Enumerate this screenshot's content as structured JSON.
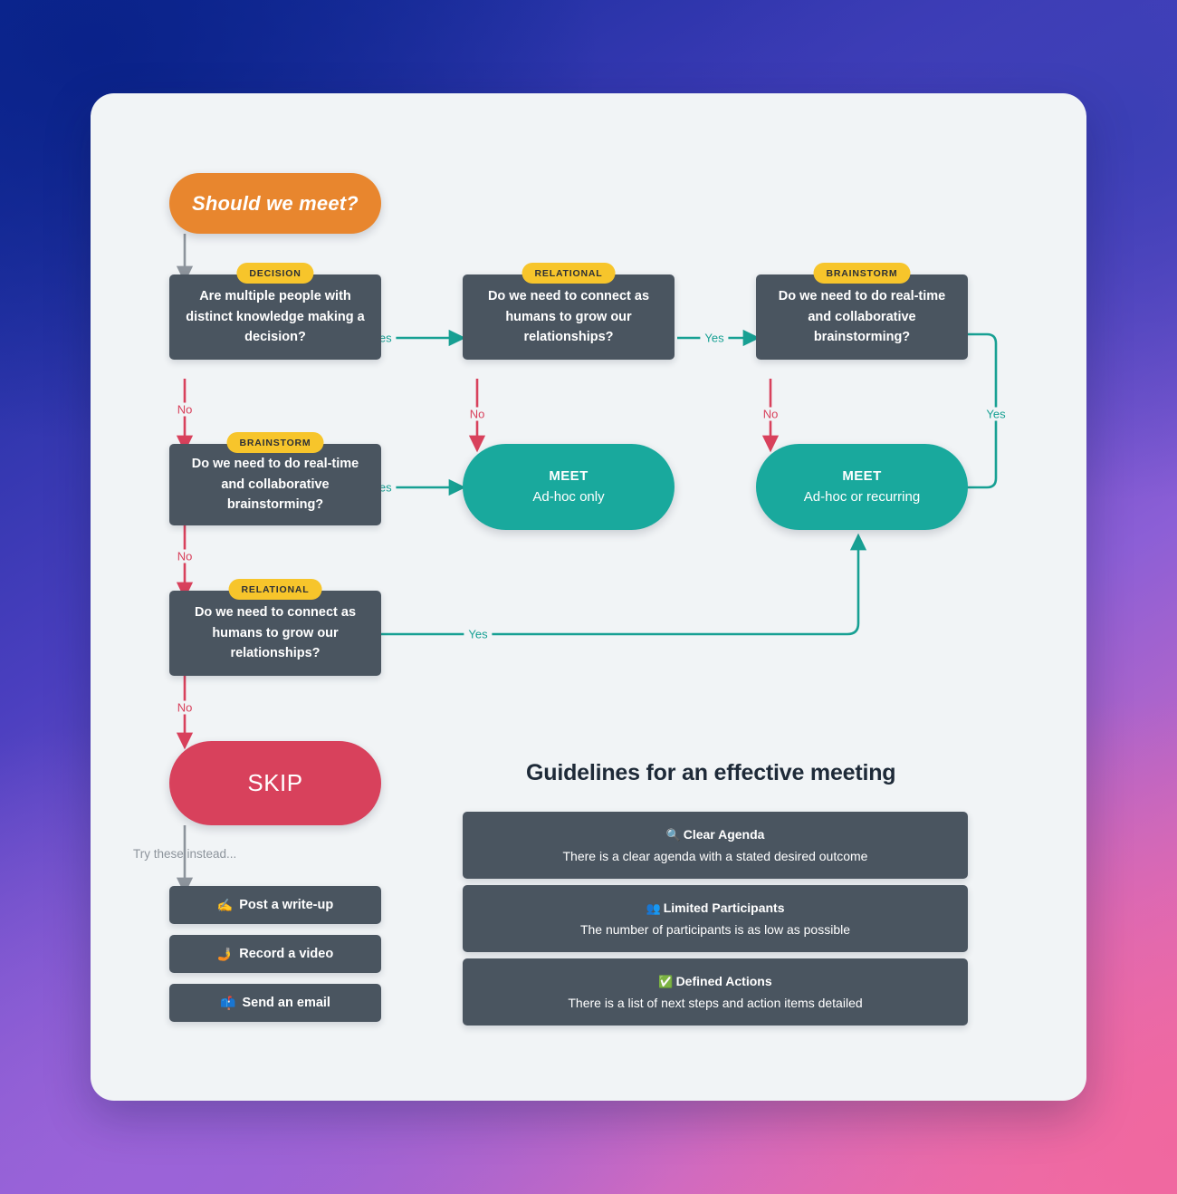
{
  "card": {
    "background": "#f1f4f6"
  },
  "colors": {
    "start": "#e8862e",
    "question": "#4a5560",
    "tag": "#f7c52b",
    "meet": "#19a99d",
    "skip": "#d8415c",
    "yes": "#17a093",
    "no": "#d8415c",
    "muted": "#8d949c"
  },
  "flow": {
    "start": {
      "label": "Should we meet?"
    },
    "q_decision": {
      "tag": "DECISION",
      "text": "Are multiple people with distinct knowledge making a decision?"
    },
    "q_relational_top": {
      "tag": "RELATIONAL",
      "text": "Do we need to connect as humans to grow our relationships?"
    },
    "q_brainstorm_top": {
      "tag": "BRAINSTORM",
      "text": "Do we need to do real-time and collaborative brainstorming?"
    },
    "q_brainstorm_left": {
      "tag": "BRAINSTORM",
      "text": "Do we need to do real-time and collaborative brainstorming?"
    },
    "q_relational_left": {
      "tag": "RELATIONAL",
      "text": "Do we need to connect as humans to grow our relationships?"
    },
    "meet_adhoc": {
      "title": "MEET",
      "subtitle": "Ad-hoc only"
    },
    "meet_recurring": {
      "title": "MEET",
      "subtitle": "Ad-hoc or recurring"
    },
    "skip": {
      "label": "SKIP"
    },
    "try_these": {
      "label": "Try these instead..."
    },
    "edge_labels": {
      "yes": "Yes",
      "no": "No"
    },
    "edges": [
      {
        "from": "q_decision",
        "to": "q_relational_top",
        "label": "Yes"
      },
      {
        "from": "q_decision",
        "to": "q_brainstorm_left",
        "label": "No"
      },
      {
        "from": "q_relational_top",
        "to": "q_brainstorm_top",
        "label": "Yes"
      },
      {
        "from": "q_relational_top",
        "to": "meet_adhoc",
        "label": "No"
      },
      {
        "from": "q_brainstorm_top",
        "to": "meet_recurring",
        "label": "Yes"
      },
      {
        "from": "q_brainstorm_top",
        "to": "meet_recurring",
        "label": "No"
      },
      {
        "from": "q_brainstorm_left",
        "to": "meet_adhoc",
        "label": "Yes"
      },
      {
        "from": "q_brainstorm_left",
        "to": "q_relational_left",
        "label": "No"
      },
      {
        "from": "q_relational_left",
        "to": "meet_recurring",
        "label": "Yes"
      },
      {
        "from": "q_relational_left",
        "to": "skip",
        "label": "No"
      }
    ]
  },
  "alternatives": [
    {
      "emoji": "✍️",
      "icon": "writing-hand-icon",
      "label": "Post a write-up"
    },
    {
      "emoji": "🤳",
      "icon": "selfie-video-icon",
      "label": "Record a video"
    },
    {
      "emoji": "📫",
      "icon": "mailbox-icon",
      "label": "Send an email"
    }
  ],
  "guidelines": {
    "title": "Guidelines for an effective meeting",
    "items": [
      {
        "emoji": "🔍",
        "icon": "magnifier-icon",
        "heading": "Clear Agenda",
        "body": "There is a clear agenda with a stated desired outcome"
      },
      {
        "emoji": "👥",
        "icon": "people-icon",
        "heading": "Limited Participants",
        "body": "The number of participants is as low as possible"
      },
      {
        "emoji": "✅",
        "icon": "check-mark-icon",
        "heading": "Defined Actions",
        "body": "There is a list of next steps and action items detailed"
      }
    ]
  }
}
